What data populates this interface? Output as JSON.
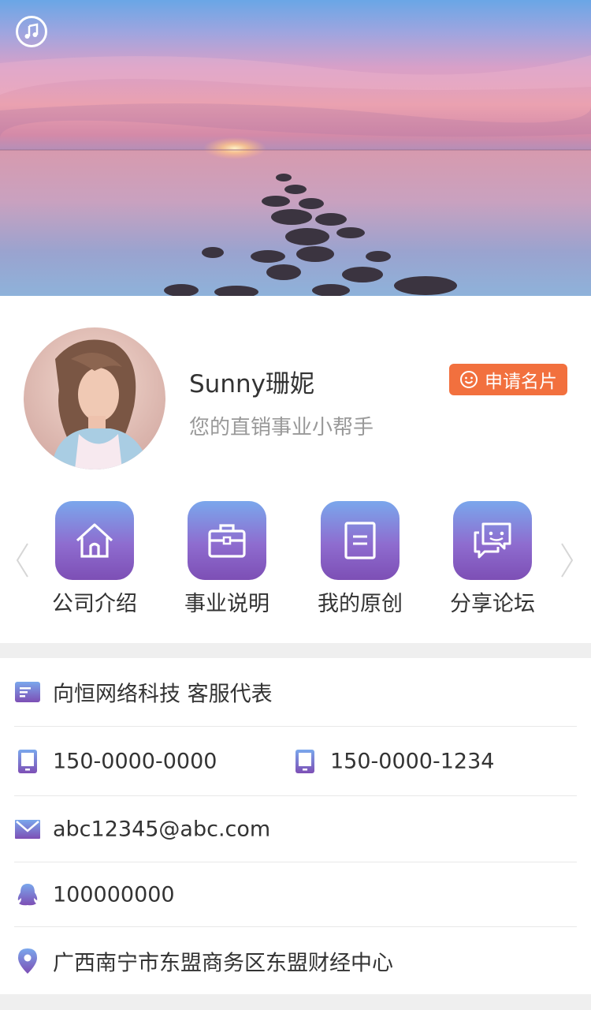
{
  "profile": {
    "name": "Sunny珊妮",
    "subtitle": "您的直销事业小帮手",
    "apply_label": "申请名片"
  },
  "nav": {
    "items": [
      {
        "label": "公司介绍",
        "icon": "home-icon"
      },
      {
        "label": "事业说明",
        "icon": "briefcase-icon"
      },
      {
        "label": "我的原创",
        "icon": "document-icon"
      },
      {
        "label": "分享论坛",
        "icon": "chat-icon"
      }
    ]
  },
  "info": {
    "company": "向恒网络科技 客服代表",
    "phone1": "150-0000-0000",
    "phone2": "150-0000-1234",
    "email": "abc12345@abc.com",
    "qq": "100000000",
    "address": "广西南宁市东盟商务区东盟财经中心"
  },
  "colors": {
    "accent": "#f2703e",
    "icon_gradient_top": "#7aa7ec",
    "icon_gradient_bottom": "#7d4fb5",
    "text": "#333333",
    "subtext": "#999999"
  }
}
